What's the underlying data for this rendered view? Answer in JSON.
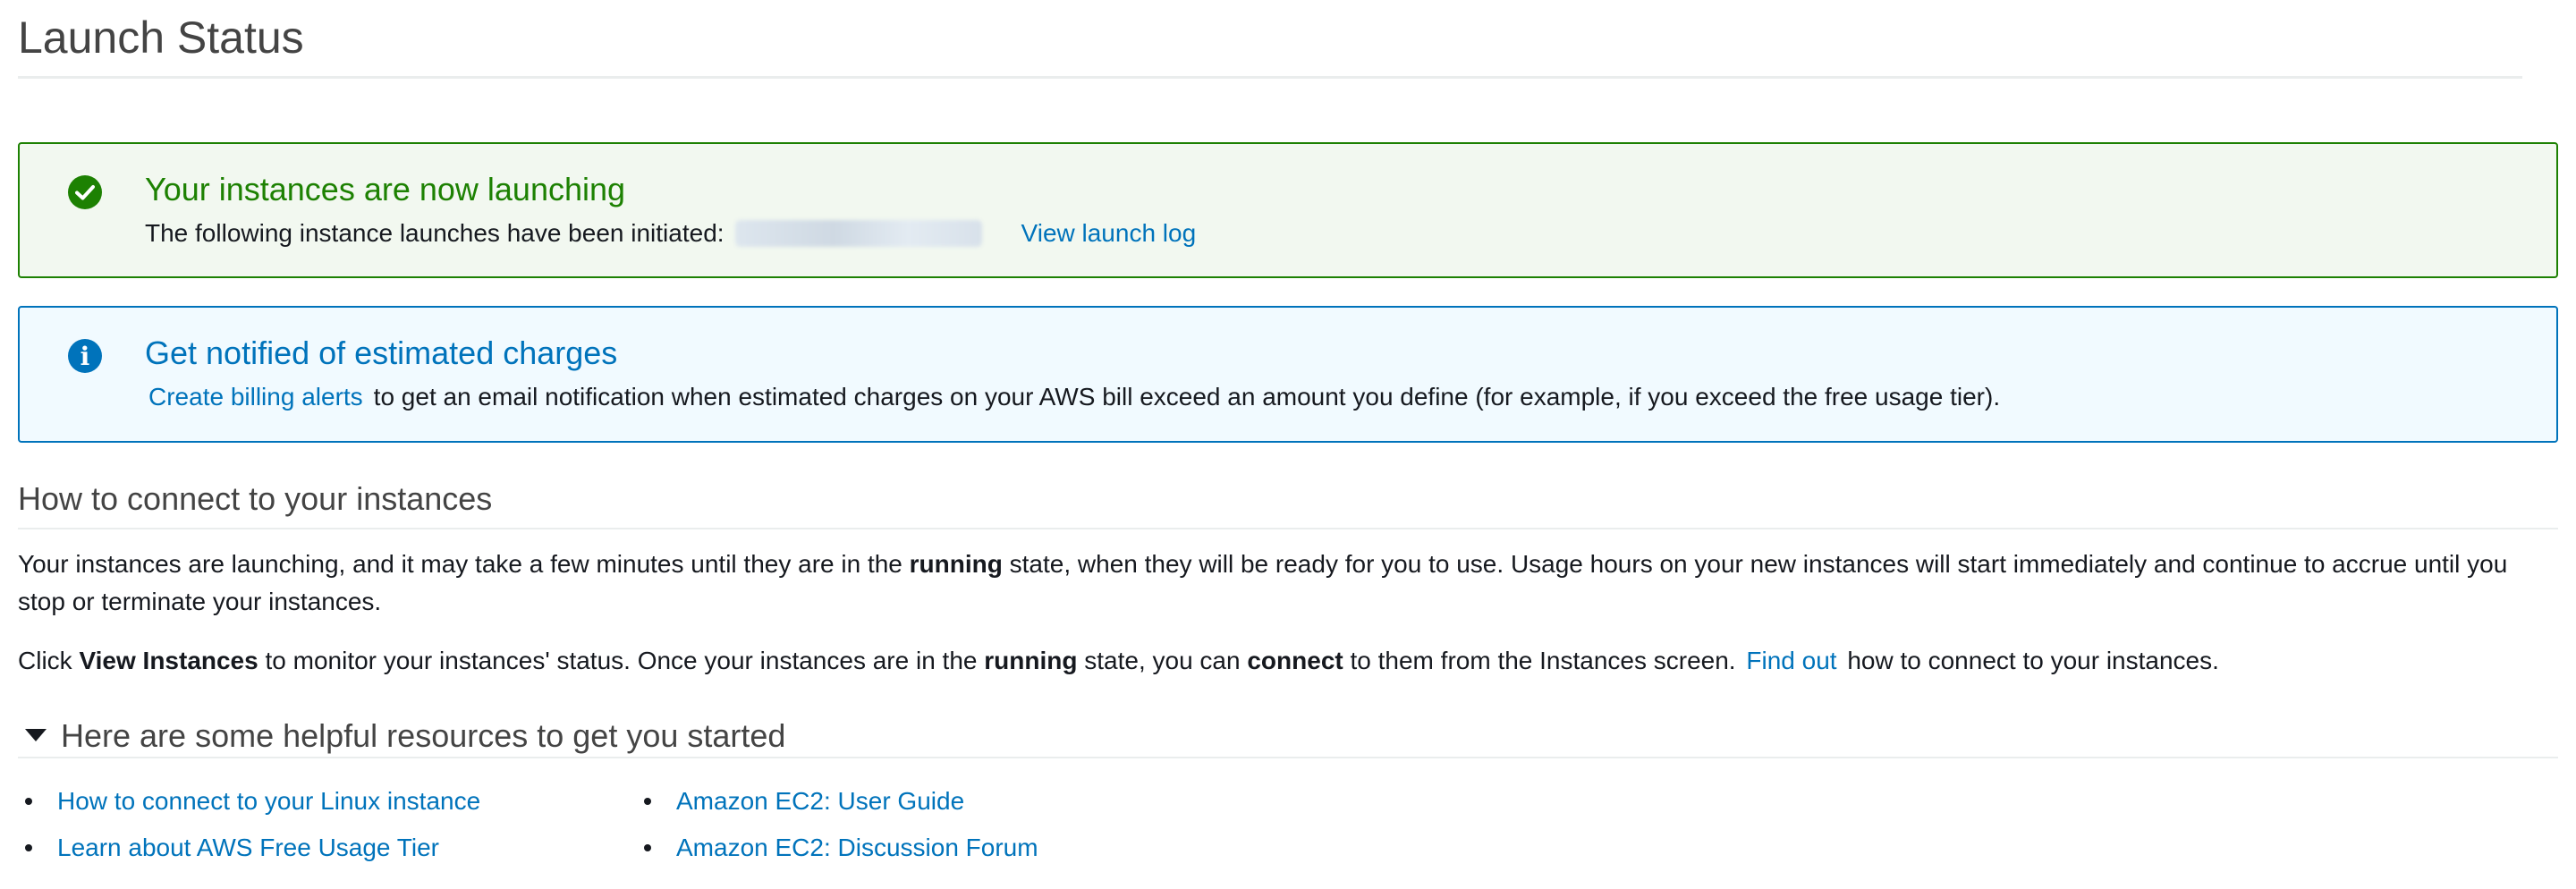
{
  "page": {
    "title": "Launch Status"
  },
  "success_alert": {
    "heading": "Your instances are now launching",
    "body_text": "The following instance launches have been initiated:",
    "link": "View launch log",
    "color": "#1d8102"
  },
  "info_alert": {
    "heading": "Get notified of estimated charges",
    "link": "Create billing alerts",
    "body_text": "to get an email notification when estimated charges on your AWS bill exceed an amount you define (for example, if you exceed the free usage tier).",
    "color": "#0073bb"
  },
  "connect_section": {
    "heading": "How to connect to your instances",
    "para1": {
      "part1": "Your instances are launching, and it may take a few minutes until they are in the",
      "bold1": "running",
      "part2": "state, when they will be ready for you to use. Usage hours on your new instances will start immediately and continue to accrue until you stop or terminate your instances."
    },
    "para2": {
      "part1": "Click",
      "bold1": "View Instances",
      "part2": "to monitor your instances' status. Once your instances are in the",
      "bold2": "running",
      "part3": "state, you can",
      "bold3": "connect",
      "part4": "to them from the Instances screen.",
      "link": "Find out",
      "part5": "how to connect to your instances."
    }
  },
  "resources_section": {
    "heading": "Here are some helpful resources to get you started",
    "left_links": [
      "How to connect to your Linux instance",
      "Learn about AWS Free Usage Tier"
    ],
    "right_links": [
      "Amazon EC2: User Guide",
      "Amazon EC2: Discussion Forum"
    ]
  }
}
